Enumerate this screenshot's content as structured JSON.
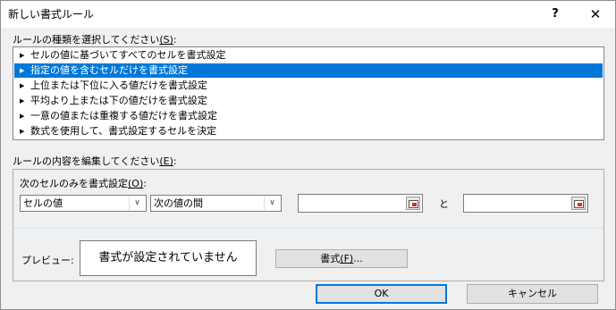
{
  "window": {
    "title": "新しい書式ルール",
    "help_label": "?",
    "close_label": "✕"
  },
  "rule_type": {
    "label": "ルールの種類を選択してください",
    "accel": "(S)",
    "accel_suffix": ":",
    "items": [
      {
        "label": "セルの値に基づいてすべてのセルを書式設定",
        "selected": false
      },
      {
        "label": "指定の値を含むセルだけを書式設定",
        "selected": true
      },
      {
        "label": "上位または下位に入る値だけを書式設定",
        "selected": false
      },
      {
        "label": "平均より上または下の値だけを書式設定",
        "selected": false
      },
      {
        "label": "一意の値または重複する値だけを書式設定",
        "selected": false
      },
      {
        "label": "数式を使用して、書式設定するセルを決定",
        "selected": false
      }
    ]
  },
  "edit_rule": {
    "label": "ルールの内容を編集してください",
    "accel": "(E)",
    "accel_suffix": ":"
  },
  "condition": {
    "label": "次のセルのみを書式設定",
    "accel": "(O)",
    "accel_suffix": ":",
    "cell_value_select": "セルの値",
    "operator_select": "次の値の間",
    "value1": "",
    "and_label": "と",
    "value2": ""
  },
  "preview": {
    "label": "プレビュー:",
    "text": "書式が設定されていません",
    "format_button": "書式",
    "format_accel": "(F)",
    "format_suffix": "..."
  },
  "footer": {
    "ok_label": "OK",
    "cancel_label": "キャンセル"
  },
  "colors": {
    "selection": "#0078d7",
    "background": "#f0f0f0"
  }
}
